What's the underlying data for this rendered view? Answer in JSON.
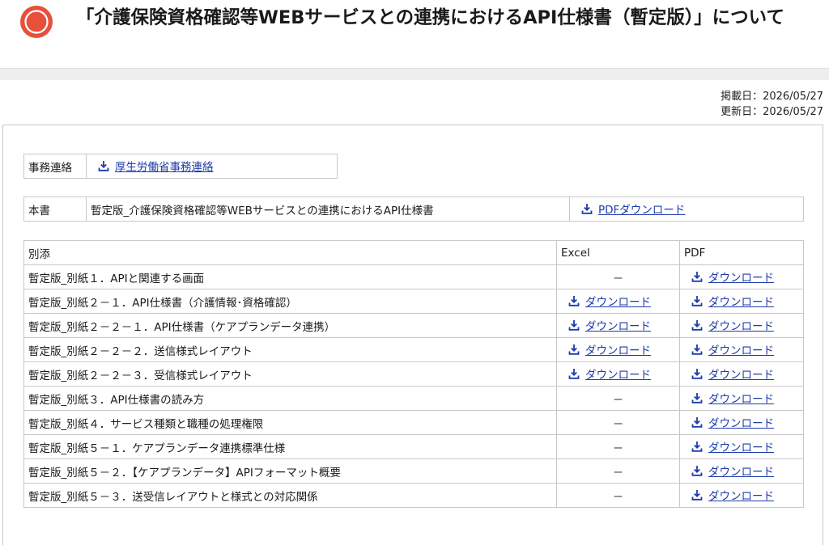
{
  "page": {
    "title": "「介護保険資格確認等WEBサービスとの連携におけるAPI仕様書（暫定版）」について",
    "posted_label": "掲載日：2026/05/27",
    "updated_label": "更新日：2026/05/27"
  },
  "notice": {
    "label": "事務連絡",
    "link_text": "厚生労働省事務連絡"
  },
  "main_doc": {
    "label": "本書",
    "name": "暫定版_介護保険資格確認等WEBサービスとの連携におけるAPI仕様書",
    "link_text": "PDFダウンロード"
  },
  "attachments": {
    "headers": [
      "別添",
      "Excel",
      "PDF"
    ],
    "download_text": "ダウンロード",
    "none_text": "－",
    "rows": [
      {
        "name": "暫定版_別紙１．APIと関連する画面",
        "excel": false,
        "pdf": true
      },
      {
        "name": "暫定版_別紙２－１．API仕様書（介護情報･資格確認）",
        "excel": true,
        "pdf": true
      },
      {
        "name": "暫定版_別紙２－２－１．API仕様書（ケアプランデータ連携）",
        "excel": true,
        "pdf": true
      },
      {
        "name": "暫定版_別紙２－２－２．送信様式レイアウト",
        "excel": true,
        "pdf": true
      },
      {
        "name": "暫定版_別紙２－２－３．受信様式レイアウト",
        "excel": true,
        "pdf": true
      },
      {
        "name": "暫定版_別紙３．API仕様書の読み方",
        "excel": false,
        "pdf": true
      },
      {
        "name": "暫定版_別紙４．サービス種類と職種の処理権限",
        "excel": false,
        "pdf": true
      },
      {
        "name": "暫定版_別紙５－１．ケアプランデータ連携標準仕様",
        "excel": false,
        "pdf": true
      },
      {
        "name": "暫定版_別紙５－２．【ケアプランデータ】APIフォーマット概要",
        "excel": false,
        "pdf": true
      },
      {
        "name": "暫定版_別紙５－３．送受信レイアウトと様式との対応関係",
        "excel": false,
        "pdf": true
      }
    ]
  },
  "colors": {
    "accent": "#e8503a",
    "link": "#1c3bab",
    "border": "#c8c8c8"
  },
  "icons": {
    "title": "record-circle-icon",
    "download": "download-icon"
  }
}
